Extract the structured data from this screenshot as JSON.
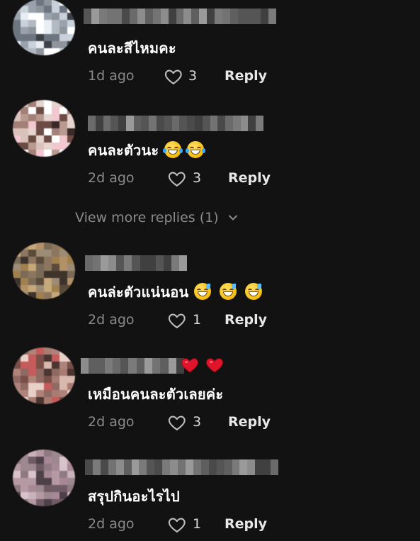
{
  "comments": [
    {
      "text": "คนละสีไหมคะ",
      "emojis": [],
      "timestamp": "1d ago",
      "likes": "3",
      "reply_label": "Reply"
    },
    {
      "text": "คนละตัวนะ",
      "emojis": [
        "face-with-tears-of-joy-emoji",
        "face-with-tears-of-joy-emoji"
      ],
      "timestamp": "2d ago",
      "likes": "3",
      "reply_label": "Reply"
    },
    {
      "text": "คนล่ะตัวแน่นอน",
      "emojis": [
        "grinning-face-with-sweat-emoji",
        "grinning-face-with-sweat-emoji",
        "grinning-face-with-sweat-emoji"
      ],
      "timestamp": "2d ago",
      "likes": "1",
      "reply_label": "Reply"
    },
    {
      "text": "เหมือนคนละตัวเลยค่ะ",
      "emojis": [],
      "username_emojis": [
        "red-heart-emoji",
        "red-heart-emoji"
      ],
      "timestamp": "2d ago",
      "likes": "3",
      "reply_label": "Reply"
    },
    {
      "text": "สรุปกินอะไรไป",
      "emojis": [],
      "timestamp": "2d ago",
      "likes": "1",
      "reply_label": "Reply"
    }
  ],
  "view_more": {
    "label": "View more replies (1)",
    "icon": "chevron-down-icon"
  },
  "colors": {
    "background": "#121212",
    "text_primary": "#ffffff",
    "text_secondary": "#8a8a8a",
    "heart_red": "#e0142b"
  }
}
